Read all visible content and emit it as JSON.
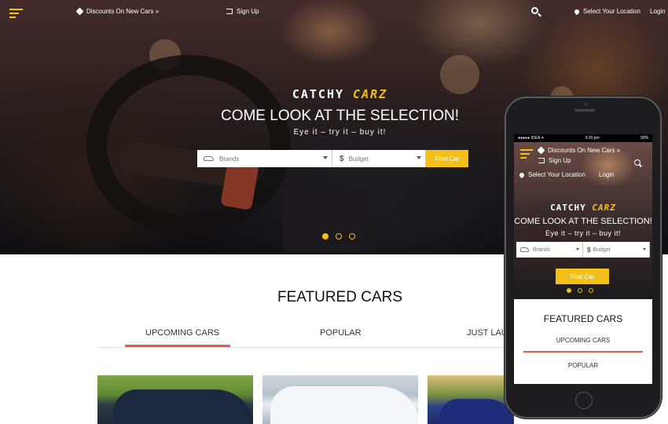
{
  "colors": {
    "accent": "#f3c01a",
    "tab_underline": "#e05a4f",
    "text_dark": "#111111"
  },
  "topbar": {
    "menu_icon": "hamburger-menu-icon",
    "discounts": "Discounts On New Cars »",
    "signup": "Sign Up",
    "search_icon": "search-icon",
    "location": "Select Your Location",
    "login": "Login"
  },
  "hero": {
    "logo_white": "CATCHY ",
    "logo_yellow": "CARZ",
    "headline": "COME LOOK AT THE SELECTION!",
    "tagline": "Eye it – try it – buy it!",
    "search": {
      "brands_placeholder": "Brands",
      "budget_placeholder": "Budget",
      "find_button": "Find Car"
    },
    "slider_active_index": 1,
    "slider_count": 3
  },
  "featured": {
    "title": "FEATURED CARS",
    "tabs": [
      "UPCOMING CARS",
      "POPULAR",
      "JUST LAUN"
    ]
  },
  "phone": {
    "status_carrier": "●●●●● IDEA ✦",
    "status_time": "9:20 pm",
    "status_battery": "90%",
    "discounts": "Discounts On New Cars »",
    "signup": "Sign Up",
    "location": "Select Your Location",
    "login": "Login",
    "logo_white": "CATCHY ",
    "logo_yellow": "CARZ",
    "headline": "COME LOOK AT THE SELECTION!",
    "tagline": "Eye it – try it – buy it!",
    "brands_placeholder": "Brands",
    "budget_placeholder": "Budget",
    "find_button": "Find Car",
    "featured_title": "FEATURED CARS",
    "tab1": "UPCOMING CARS",
    "tab2": "POPULAR"
  }
}
